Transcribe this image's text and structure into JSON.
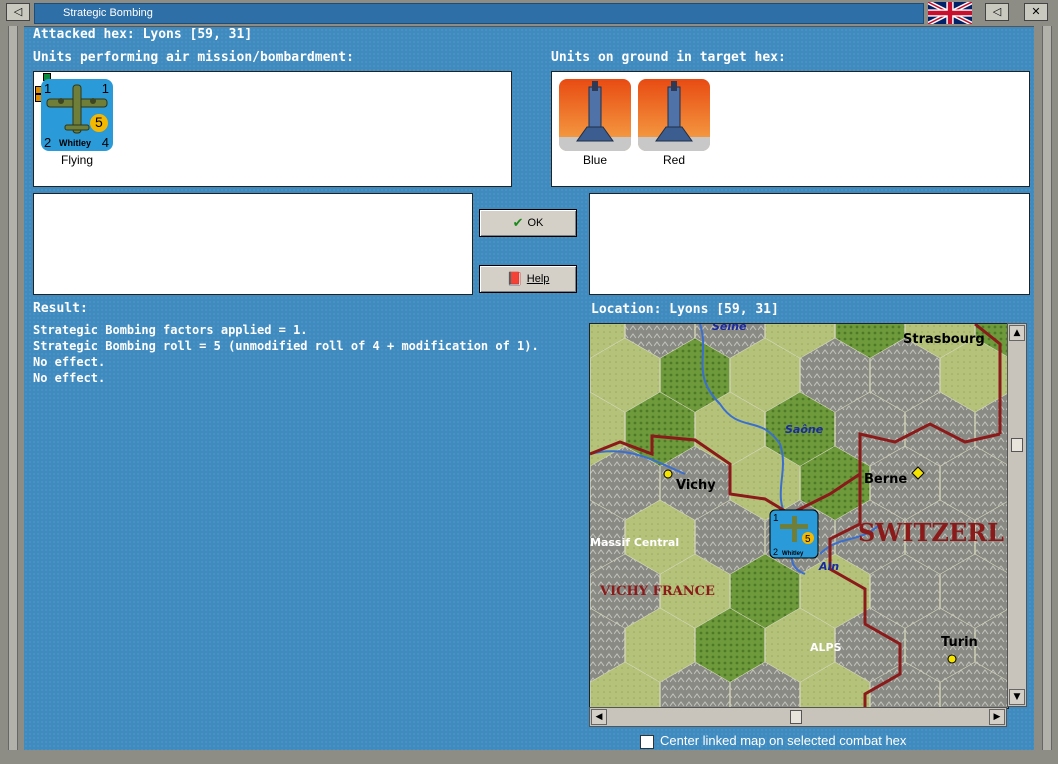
{
  "window": {
    "title": "Strategic Bombing",
    "flag_icon": "uk-flag-icon"
  },
  "header": {
    "attacked_hex": "Attacked hex: Lyons  [59, 31]"
  },
  "air_units": {
    "heading": "Units performing air mission/bombardment:",
    "items": [
      {
        "name": "Whitley",
        "status": "Flying",
        "top_left": "1",
        "top_right": "1",
        "bottom_left": "2",
        "bottom_right": "4",
        "strength": "5"
      }
    ]
  },
  "ground_units": {
    "heading": "Units on ground in target hex:",
    "items": [
      {
        "name": "Blue"
      },
      {
        "name": "Red"
      }
    ]
  },
  "buttons": {
    "ok": "OK",
    "help": "Help"
  },
  "result": {
    "heading": "Result:",
    "lines": [
      "Strategic Bombing factors applied = 1.",
      "Strategic Bombing roll = 5 (unmodified roll of 4 + modification of 1).",
      "No effect.",
      "No effect."
    ]
  },
  "location": {
    "heading": "Location:  Lyons  [59, 31]",
    "map_labels": {
      "seine": "Seine",
      "strasbourg": "Strasbourg",
      "saone": "Saône",
      "vichy": "Vichy",
      "berne": "Berne",
      "switzerland": "SWITZERL",
      "massif": "Massif Central",
      "vichy_france": "VICHY FRANCE",
      "ain": "Ain",
      "alps": "ALPS",
      "turin": "Turin"
    },
    "map_unit": {
      "name": "Whitley",
      "top_left": "1",
      "bottom_left": "2",
      "strength": "5"
    }
  },
  "center_checkbox": {
    "label": "Center linked map on selected combat hex",
    "checked": false
  },
  "colors": {
    "background": "#3f8bc0",
    "border_red": "#8b1a1a",
    "counter_blue": "#2a9ad8"
  }
}
